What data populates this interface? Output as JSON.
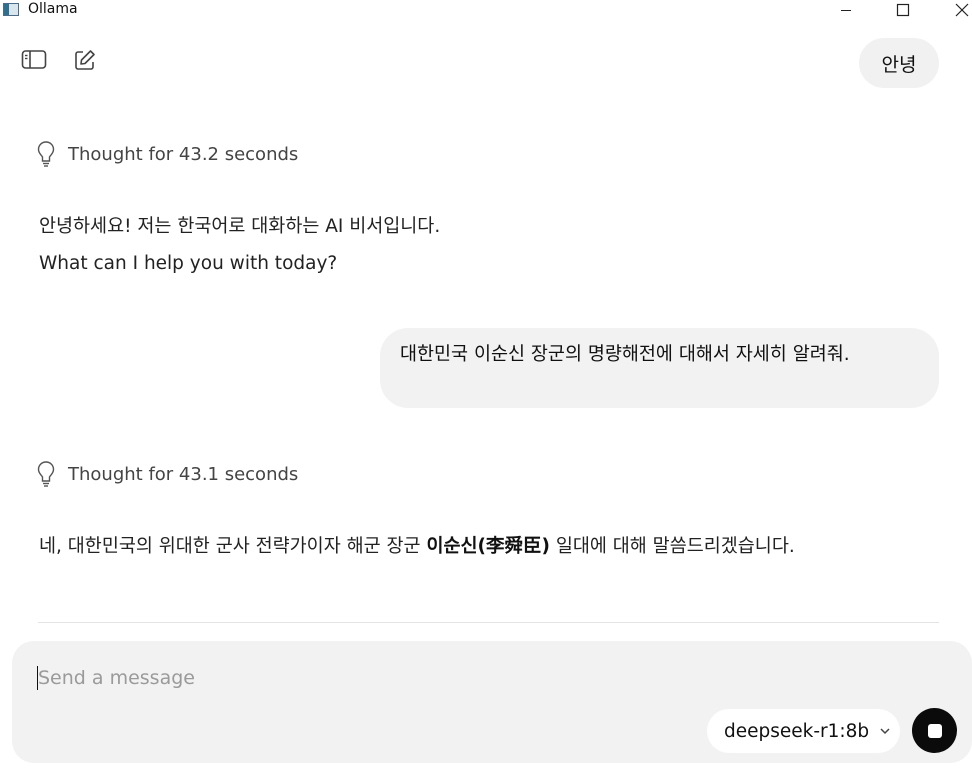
{
  "window": {
    "title": "Ollama",
    "icons": [
      "app-icon",
      "minimize-icon",
      "maximize-icon",
      "close-icon"
    ]
  },
  "toolbar": {
    "sidebar_icon": "sidebar-toggle-icon",
    "new_chat_icon": "new-chat-icon",
    "greeting": "안녕"
  },
  "messages": [
    {
      "role": "assistant",
      "thought": "Thought for 43.2 seconds",
      "lines": [
        "안녕하세요! 저는 한국어로 대화하는 AI 비서입니다.",
        "What can I help you with today?"
      ]
    },
    {
      "role": "user",
      "text": "대한민국 이순신 장군의 명량해전에 대해서 자세히 알려줘."
    },
    {
      "role": "assistant",
      "thought": "Thought for 43.1 seconds",
      "prefix": "네, 대한민국의 위대한 군사 전략가이자 해군 장군 ",
      "bold": "이순신(李舜臣)",
      "suffix": " 일대에 대해 말씀드리겠습니다."
    }
  ],
  "composer": {
    "placeholder": "Send a message",
    "value": "",
    "model": "deepseek-r1:8b",
    "stop_icon": "stop-icon"
  }
}
